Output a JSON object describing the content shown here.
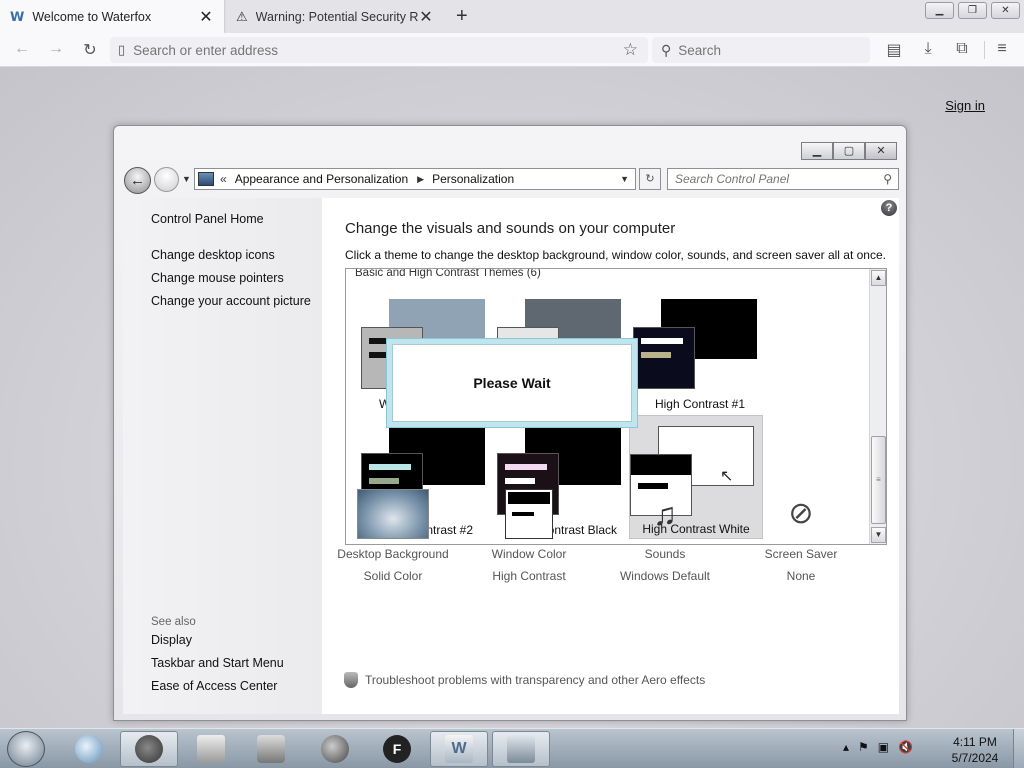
{
  "browser": {
    "tabs": [
      {
        "title": "Welcome to Waterfox",
        "icon": "waterfox-icon",
        "active": true
      },
      {
        "title": "Warning: Potential Security Risk",
        "icon": "warning-icon",
        "active": false
      }
    ],
    "address_placeholder": "Search or enter address",
    "search_placeholder": "Search"
  },
  "page": {
    "signin_label": "Sign in"
  },
  "control_panel": {
    "breadcrumb": [
      "Appearance and Personalization",
      "Personalization"
    ],
    "search_placeholder": "Search Control Panel",
    "left_links": [
      "Control Panel Home",
      "Change desktop icons",
      "Change mouse pointers",
      "Change your account picture"
    ],
    "see_also_label": "See also",
    "see_also_links": [
      "Display",
      "Taskbar and Start Menu",
      "Ease of Access Center"
    ],
    "heading": "Change the visuals and sounds on your computer",
    "description": "Click a theme to change the desktop background, window color, sounds, and screen saver all at once.",
    "group_label": "Basic and High Contrast Themes (6)",
    "themes": [
      {
        "label": "W",
        "desk_color": "#8fa3b4",
        "win_color": "#b7b7b7",
        "bar1": "#111111",
        "bar2": "#111111"
      },
      {
        "label": "",
        "desk_color": "#5f6770",
        "win_color": "#e6e6e6",
        "bar1": "#222222",
        "bar2": "#222222"
      },
      {
        "label": "High Contrast #1",
        "desk_color": "#000000",
        "win_color": "#0b0b1e",
        "bar1": "#ffffff",
        "bar2": "#b8b38a"
      },
      {
        "label": "High Contrast #2",
        "desk_color": "#000000",
        "win_color": "#000000",
        "bar1": "#b9e6e6",
        "bar2": "#9aa88a"
      },
      {
        "label": "High Contrast Black",
        "desk_color": "#000000",
        "win_color": "#1a1016",
        "bar1": "#f1d9f0",
        "bar2": "#ffffff"
      },
      {
        "label": "High Contrast White",
        "desk_color": "#ffffff",
        "win_color": "#ffffff",
        "bar1": "#000000",
        "bar2": "#000000"
      }
    ],
    "wait_text": "Please Wait",
    "bottom": [
      {
        "title": "Desktop Background",
        "sub": "Solid Color",
        "icon": "desktop-background-icon"
      },
      {
        "title": "Window Color",
        "sub": "High Contrast",
        "icon": "window-color-icon"
      },
      {
        "title": "Sounds",
        "sub": "Windows Default",
        "icon": "sounds-icon"
      },
      {
        "title": "Screen Saver",
        "sub": "None",
        "icon": "screen-saver-icon"
      }
    ],
    "troubleshoot": "Troubleshoot problems with transparency and other Aero effects"
  },
  "taskbar": {
    "time": "4:11 PM",
    "date": "5/7/2024"
  }
}
